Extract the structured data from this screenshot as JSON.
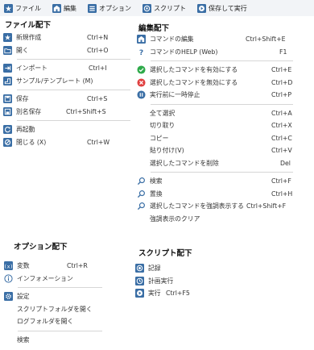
{
  "menubar": [
    {
      "label": "ファイル",
      "icon": "file-menu-icon"
    },
    {
      "label": "編集",
      "icon": "edit-menu-icon"
    },
    {
      "label": "オプション",
      "icon": "options-menu-icon"
    },
    {
      "label": "スクリプト",
      "icon": "script-menu-icon"
    },
    {
      "label": "保存して実行",
      "icon": "save-run-icon"
    }
  ],
  "file_menu": {
    "title": "ファイル配下",
    "groups": [
      [
        {
          "label": "新規作成",
          "shortcut": "Ctrl+N",
          "icon": "new-file-icon"
        },
        {
          "label": "開く",
          "shortcut": "Ctrl+O",
          "icon": "open-folder-icon"
        }
      ],
      [
        {
          "label": "インポート",
          "shortcut": "Ctrl+I",
          "icon": "import-icon"
        },
        {
          "label": "サンプル/テンプレート (M)",
          "shortcut": "",
          "icon": "template-icon"
        }
      ],
      [
        {
          "label": "保存",
          "shortcut": "Ctrl+S",
          "icon": "save-icon"
        },
        {
          "label": "別名保存",
          "shortcut": "Ctrl+Shift+S",
          "icon": "save-as-icon"
        }
      ],
      [
        {
          "label": "再起動",
          "shortcut": "",
          "icon": "restart-icon"
        },
        {
          "label": "閉じる (X)",
          "shortcut": "Ctrl+W",
          "icon": "close-icon"
        }
      ]
    ]
  },
  "edit_menu": {
    "title": "編集配下",
    "groups": [
      [
        {
          "label": "コマンドの編集",
          "shortcut": "Ctrl+Shift+E",
          "icon": "edit-command-icon"
        },
        {
          "label": "コマンドのHELP (Web)",
          "shortcut": "F1",
          "icon": "help-icon"
        }
      ],
      [
        {
          "label": "選択したコマンドを有効にする",
          "shortcut": "Ctrl+E",
          "icon": "enable-icon"
        },
        {
          "label": "選択したコマンドを無効にする",
          "shortcut": "Ctrl+D",
          "icon": "disable-icon"
        },
        {
          "label": "実行前に一時停止",
          "shortcut": "Ctrl+P",
          "icon": "pause-icon"
        }
      ],
      [
        {
          "label": "全て選択",
          "shortcut": "Ctrl+A",
          "icon": ""
        },
        {
          "label": "切り取り",
          "shortcut": "Ctrl+X",
          "icon": ""
        },
        {
          "label": "コピー",
          "shortcut": "Ctrl+C",
          "icon": ""
        },
        {
          "label": "貼り付け(V)",
          "shortcut": "Ctrl+V",
          "icon": ""
        },
        {
          "label": "選択したコマンドを削除",
          "shortcut": "Del",
          "icon": ""
        }
      ],
      [
        {
          "label": "検索",
          "shortcut": "Ctrl+F",
          "icon": "search-icon"
        },
        {
          "label": "置換",
          "shortcut": "Ctrl+H",
          "icon": "replace-icon"
        },
        {
          "label": "選択したコマンドを強調表示する",
          "shortcut": "Ctrl+Shift+F",
          "icon": "highlight-icon"
        },
        {
          "label": "強調表示のクリア",
          "shortcut": "",
          "icon": ""
        }
      ]
    ]
  },
  "options_menu": {
    "title": "オプション配下",
    "groups": [
      [
        {
          "label": "変数",
          "shortcut": "Ctrl+R",
          "icon": "variable-icon"
        },
        {
          "label": "インフォメーション",
          "shortcut": "",
          "icon": "info-icon"
        }
      ],
      [
        {
          "label": "設定",
          "shortcut": "",
          "icon": "settings-icon"
        },
        {
          "label": "スクリプトフォルダを開く",
          "shortcut": "",
          "icon": ""
        },
        {
          "label": "ログフォルダを開く",
          "shortcut": "",
          "icon": ""
        }
      ],
      [
        {
          "label": "検索",
          "shortcut": "",
          "icon": ""
        }
      ]
    ]
  },
  "script_menu": {
    "title": "スクリプト配下",
    "groups": [
      [
        {
          "label": "記録",
          "shortcut": "",
          "icon": "record-icon"
        },
        {
          "label": "計画実行",
          "shortcut": "",
          "icon": "schedule-icon"
        },
        {
          "label": "実行",
          "shortcut": "Ctrl+F5",
          "icon": "run-icon"
        }
      ]
    ]
  }
}
